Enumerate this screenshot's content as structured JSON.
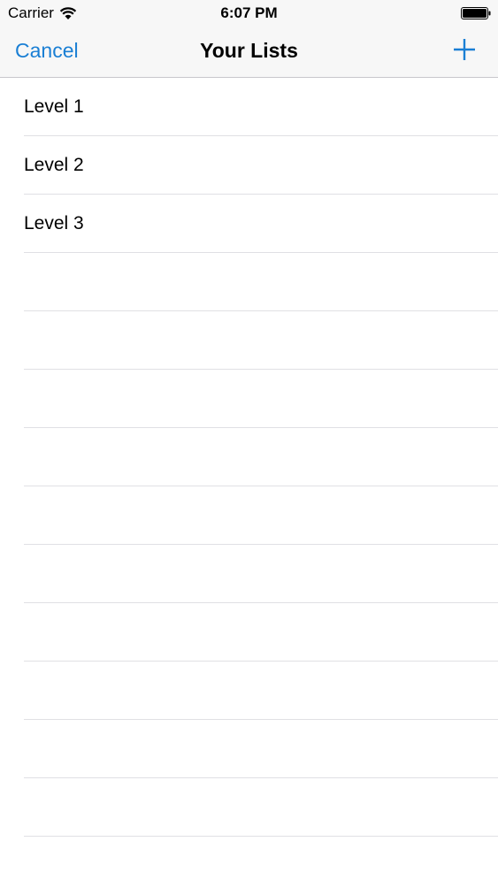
{
  "status_bar": {
    "carrier": "Carrier",
    "time": "6:07 PM"
  },
  "nav": {
    "cancel_label": "Cancel",
    "title": "Your Lists",
    "add_icon": "plus-icon",
    "tint_color": "#1a7fd4"
  },
  "lists": {
    "items": [
      {
        "label": "Level 1"
      },
      {
        "label": "Level 2"
      },
      {
        "label": "Level 3"
      },
      {
        "label": ""
      },
      {
        "label": ""
      },
      {
        "label": ""
      },
      {
        "label": ""
      },
      {
        "label": ""
      },
      {
        "label": ""
      },
      {
        "label": ""
      },
      {
        "label": ""
      },
      {
        "label": ""
      },
      {
        "label": ""
      },
      {
        "label": ""
      }
    ]
  }
}
